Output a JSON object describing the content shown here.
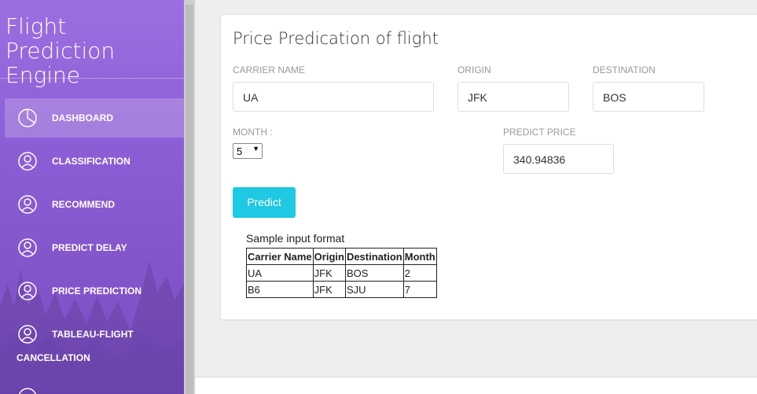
{
  "brand": {
    "title_line1": "Flight Prediction",
    "title_line2": "Engine"
  },
  "nav": [
    {
      "label": "DASHBOARD",
      "icon": "pie-chart-icon",
      "active": true
    },
    {
      "label": "CLASSIFICATION",
      "icon": "user-icon"
    },
    {
      "label": "RECOMMEND",
      "icon": "user-icon"
    },
    {
      "label": "PREDICT DELAY",
      "icon": "user-icon"
    },
    {
      "label": "PRICE PREDICTION",
      "icon": "user-icon"
    },
    {
      "label": "TABLEAU-FLIGHT",
      "label2": "CANCELLATION",
      "icon": "user-icon"
    }
  ],
  "form": {
    "title": "Price Predication of flight",
    "carrier_label": "CARRIER NAME",
    "carrier_value": "UA",
    "origin_label": "ORIGIN",
    "origin_value": "JFK",
    "destination_label": "DESTINATION",
    "destination_value": "BOS",
    "month_label": "MONTH :",
    "month_value": "5",
    "predict_price_label": "PREDICT PRICE",
    "predict_price_value": "340.94836",
    "predict_button": "Predict"
  },
  "sample": {
    "caption": "Sample input format",
    "headers": [
      "Carrier Name",
      "Origin",
      "Destination",
      "Month"
    ],
    "rows": [
      [
        "UA",
        "JFK",
        "BOS",
        "2"
      ],
      [
        "B6",
        "JFK",
        "SJU",
        "7"
      ]
    ]
  },
  "colors": {
    "sidebar": "#8d5fd6",
    "accent_button": "#1fc8e3"
  }
}
